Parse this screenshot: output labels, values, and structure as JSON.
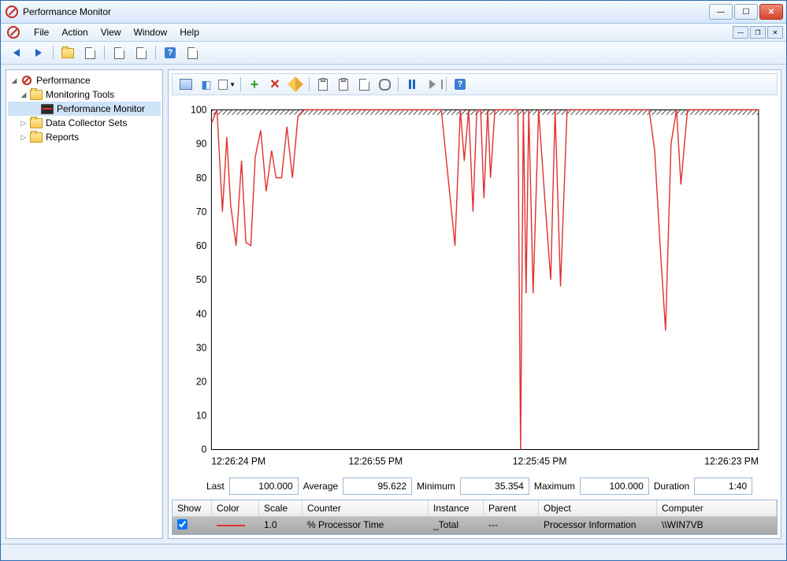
{
  "window": {
    "title": "Performance Monitor"
  },
  "menu": {
    "file": "File",
    "action": "Action",
    "view": "View",
    "window": "Window",
    "help": "Help"
  },
  "tree": {
    "root": "Performance",
    "monitoring_tools": "Monitoring Tools",
    "performance_monitor": "Performance Monitor",
    "data_collector_sets": "Data Collector Sets",
    "reports": "Reports"
  },
  "stats": {
    "last_label": "Last",
    "last": "100.000",
    "avg_label": "Average",
    "avg": "95.622",
    "min_label": "Minimum",
    "min": "35.354",
    "max_label": "Maximum",
    "max": "100.000",
    "dur_label": "Duration",
    "dur": "1:40"
  },
  "grid": {
    "headers": {
      "show": "Show",
      "color": "Color",
      "scale": "Scale",
      "counter": "Counter",
      "instance": "Instance",
      "parent": "Parent",
      "object": "Object",
      "computer": "Computer"
    },
    "row": {
      "show": "✔",
      "scale": "1.0",
      "counter": "% Processor Time",
      "instance": "_Total",
      "parent": "---",
      "object": "Processor Information",
      "computer": "\\\\WIN7VB"
    }
  },
  "chart_data": {
    "type": "line",
    "title": "",
    "xlabel": "",
    "ylabel": "",
    "ylim": [
      0,
      100
    ],
    "y_ticks": [
      0,
      10,
      20,
      30,
      40,
      50,
      60,
      70,
      80,
      90,
      100
    ],
    "x_tick_labels": [
      "12:26:24 PM",
      "12:26:55 PM",
      "12:25:45 PM",
      "12:26:23 PM"
    ],
    "x_tick_positions": [
      0,
      0.3,
      0.6,
      1.0
    ],
    "series": [
      {
        "name": "% Processor Time",
        "color": "#e03131",
        "x": [
          0.0,
          0.01,
          0.02,
          0.028,
          0.035,
          0.045,
          0.055,
          0.063,
          0.072,
          0.08,
          0.09,
          0.1,
          0.11,
          0.118,
          0.128,
          0.138,
          0.148,
          0.158,
          0.17,
          0.185,
          0.22,
          0.3,
          0.42,
          0.445,
          0.455,
          0.462,
          0.47,
          0.478,
          0.485,
          0.492,
          0.498,
          0.505,
          0.51,
          0.518,
          0.525,
          0.56,
          0.565,
          0.57,
          0.575,
          0.58,
          0.588,
          0.598,
          0.61,
          0.62,
          0.628,
          0.638,
          0.65,
          0.72,
          0.8,
          0.81,
          0.82,
          0.83,
          0.84,
          0.85,
          0.858,
          0.87,
          0.89,
          1.0
        ],
        "values": [
          96,
          100,
          70,
          92,
          72,
          60,
          85,
          61,
          60,
          86,
          94,
          76,
          88,
          80,
          80,
          95,
          80,
          98,
          100,
          100,
          100,
          100,
          100,
          60,
          100,
          85,
          100,
          70,
          100,
          100,
          74,
          100,
          80,
          100,
          100,
          100,
          0,
          100,
          46,
          100,
          46,
          100,
          72,
          50,
          100,
          48,
          100,
          100,
          100,
          88,
          60,
          35,
          90,
          100,
          78,
          100,
          100,
          100
        ]
      }
    ]
  }
}
